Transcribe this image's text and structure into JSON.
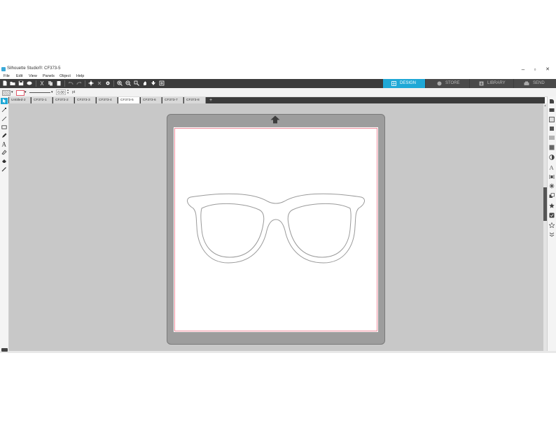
{
  "window": {
    "title": "Silhouette Studio®: CF373-5",
    "minimize": "–",
    "maximize": "▫",
    "close": "✕"
  },
  "menu": [
    "File",
    "Edit",
    "View",
    "Panels",
    "Object",
    "Help"
  ],
  "mode_tabs": [
    {
      "label": "DESIGN",
      "icon": "design-grid-icon",
      "active": true
    },
    {
      "label": "STORE",
      "icon": "store-globe-icon",
      "active": false
    },
    {
      "label": "LIBRARY",
      "icon": "library-icon",
      "active": false
    },
    {
      "label": "SEND",
      "icon": "send-icon",
      "active": false
    }
  ],
  "style_bar": {
    "line_width": "0.00",
    "unit": "pt"
  },
  "doc_tabs": [
    {
      "label": "Untitled-2",
      "active": false
    },
    {
      "label": "CF372-1",
      "active": false
    },
    {
      "label": "CF372-2",
      "active": false
    },
    {
      "label": "CF373-3",
      "active": false
    },
    {
      "label": "CF373-4",
      "active": false
    },
    {
      "label": "CF373-5",
      "active": true
    },
    {
      "label": "CF373-6",
      "active": false
    },
    {
      "label": "CF373-7",
      "active": false
    },
    {
      "label": "CF373-8",
      "active": false
    }
  ],
  "colors": {
    "accent": "#1fa8d6",
    "toolbar": "#3c3c3c",
    "workspace": "#c8c8c8",
    "mat": "#9d9d9d",
    "cut_border": "#f08a9a"
  },
  "left_tools": [
    "select-arrow-icon",
    "point-edit-icon",
    "line-icon",
    "rectangle-icon",
    "pencil-icon",
    "text-icon",
    "fill-icon",
    "eraser-icon",
    "knife-icon"
  ],
  "right_panel": [
    "page-setup-icon",
    "send-panel-icon",
    "library-panel-icon",
    "store-panel-icon",
    "line-style-icon",
    "fill-panel-icon",
    "gradient-icon",
    "text-style-icon",
    "align-icon",
    "replicate-icon",
    "modify-icon",
    "offset-icon",
    "trace-icon",
    "rhinestone-icon",
    "sketch-icon"
  ]
}
